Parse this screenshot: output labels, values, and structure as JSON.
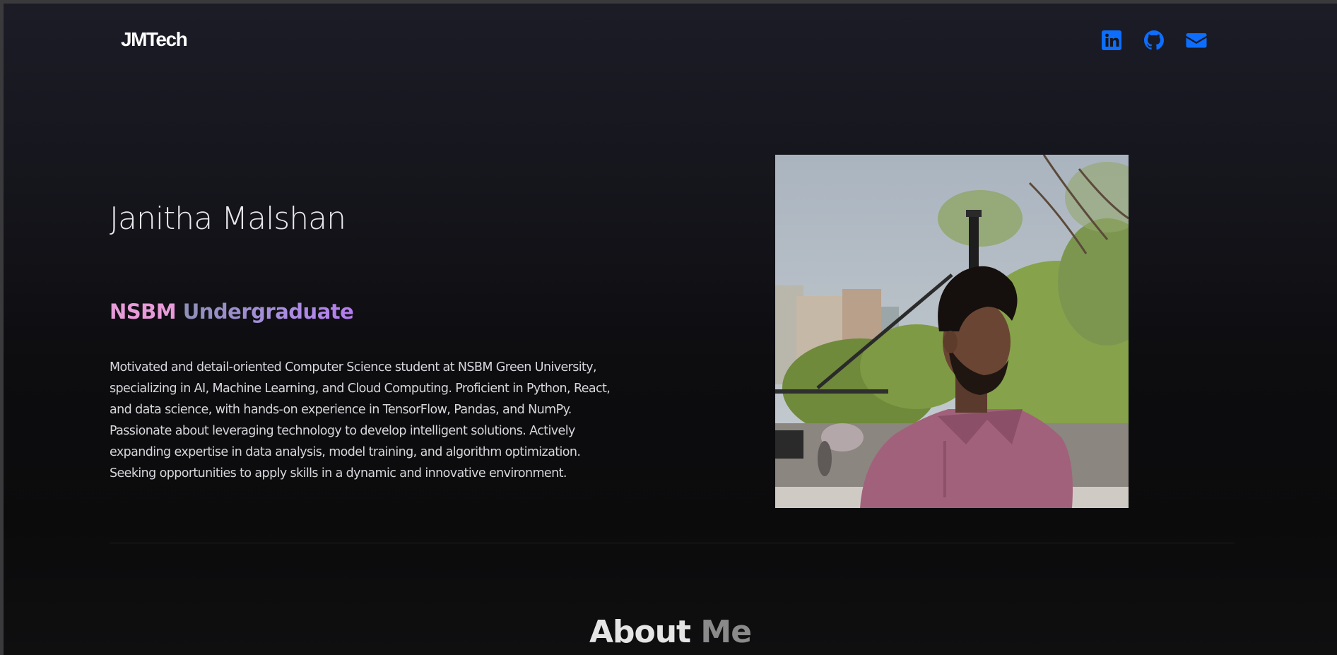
{
  "header": {
    "logo_text": "JMTech",
    "social_links": [
      {
        "icon": "linkedin-icon",
        "color": "#0d6efd"
      },
      {
        "icon": "github-icon",
        "color": "#0d6efd"
      },
      {
        "icon": "envelope-icon",
        "color": "#0d6efd"
      }
    ]
  },
  "hero": {
    "name": "Janitha Malshan",
    "subtitle_part1": "NSBM",
    "subtitle_part2": "Undergraduate",
    "bio": "Motivated and detail-oriented Computer Science student at NSBM Green University, specializing in AI, Machine Learning, and Cloud Computing. Proficient in Python, React, and data science, with hands-on experience in TensorFlow, Pandas, and NumPy. Passionate about leveraging technology to develop intelligent solutions. Actively expanding expertise in data analysis, model training, and algorithm optimization. Seeking opportunities to apply skills in a dynamic and innovative environment."
  },
  "about": {
    "title_part1": "About",
    "title_part2": "Me"
  },
  "colors": {
    "accent_blue": "#0d6efd",
    "subtitle_pink": "#e79bd8",
    "subtitle_purple": "#b57cf0"
  }
}
